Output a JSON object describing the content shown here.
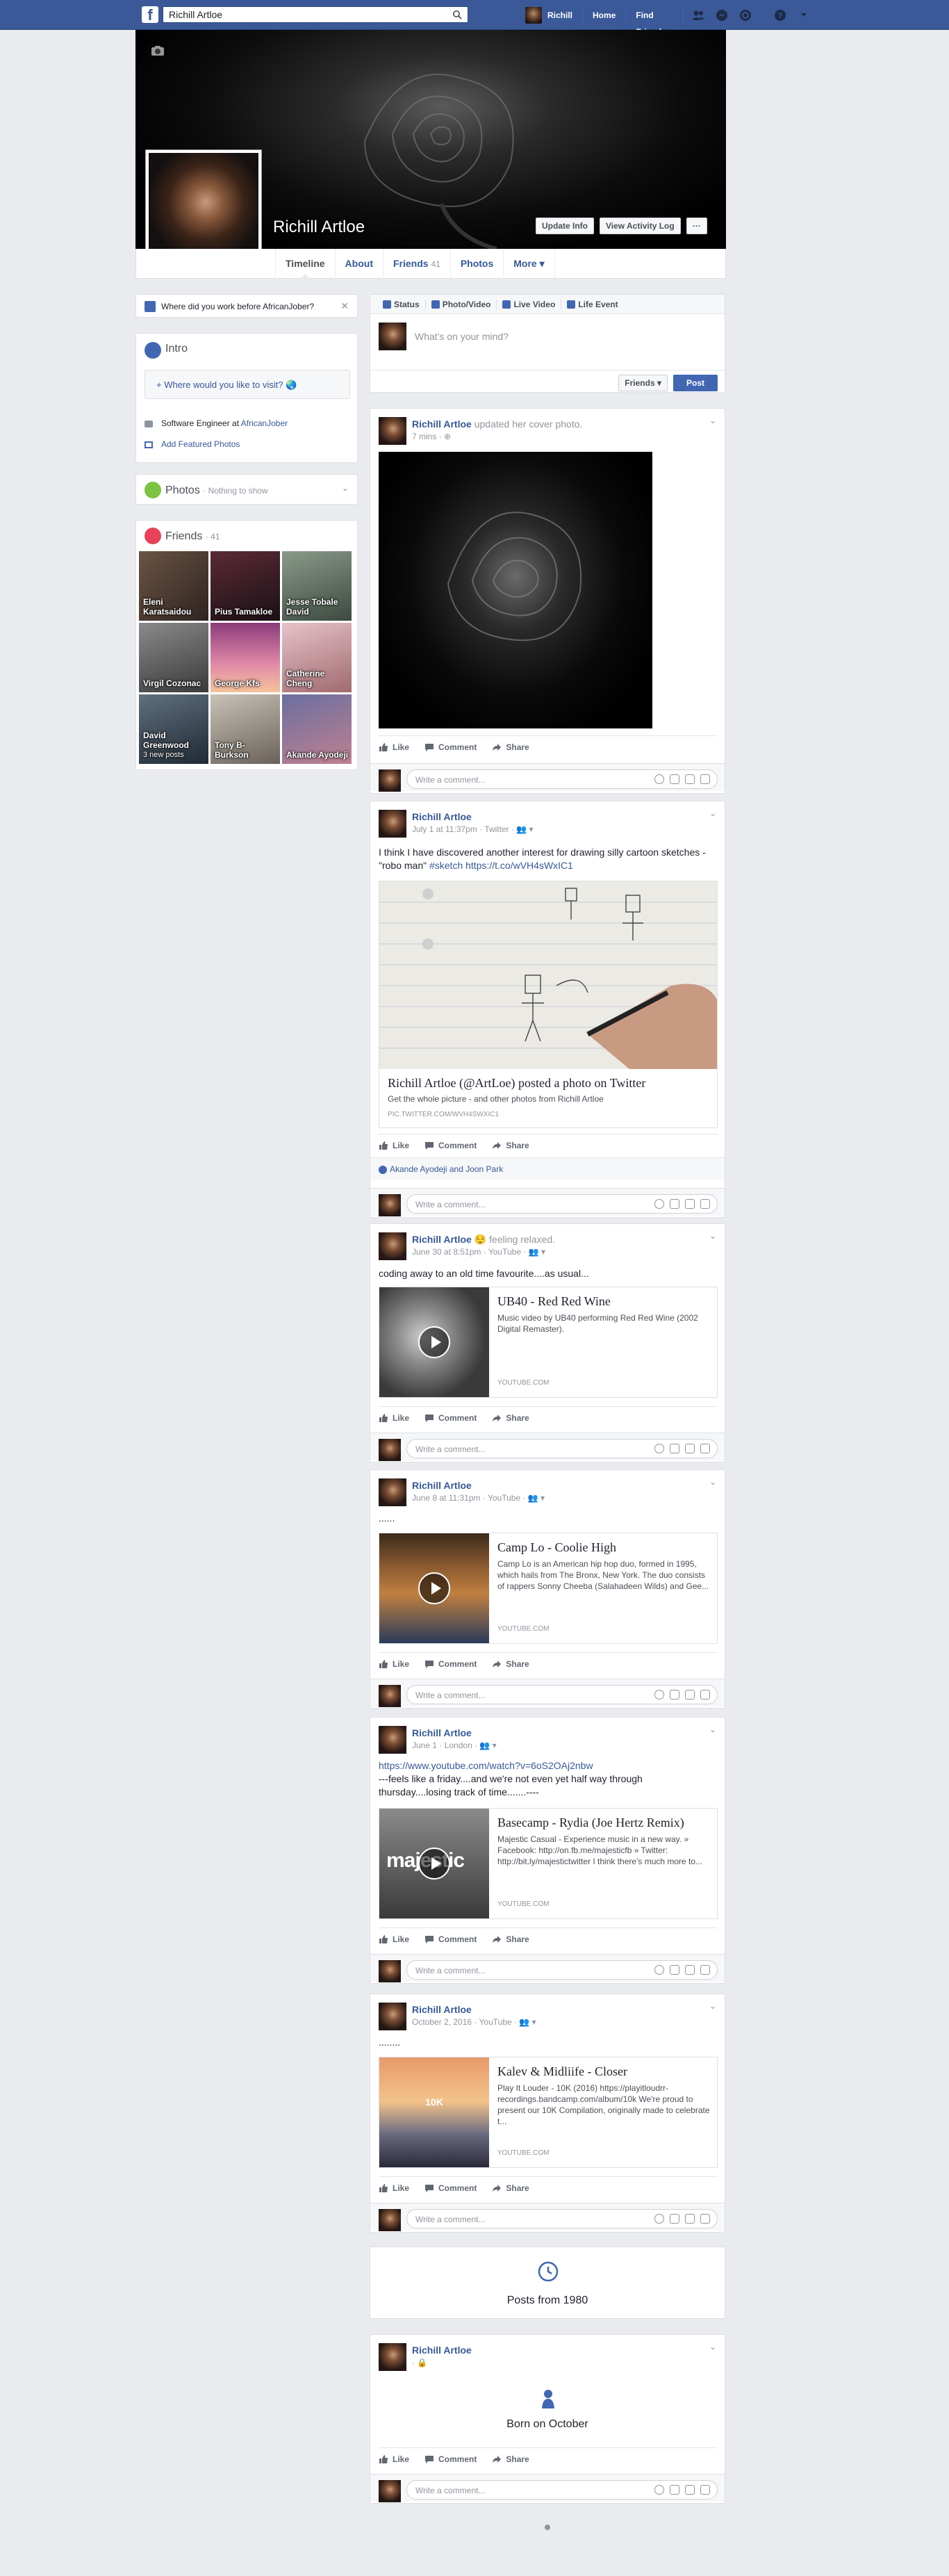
{
  "topbar": {
    "search_value": "Richill Artloe",
    "profile_name": "Richill",
    "home": "Home",
    "find_friends": "Find Friends"
  },
  "profile": {
    "name": "Richill Artloe",
    "update_info": "Update Info",
    "activity_log": "View Activity Log",
    "more_dots": "···"
  },
  "tabs": {
    "timeline": "Timeline",
    "about": "About",
    "friends": "Friends",
    "friends_count": "41",
    "photos": "Photos",
    "more": "More ▾"
  },
  "left": {
    "work_question": "Where did you work before AfricanJober?",
    "intro_title": "Intro",
    "visit_prompt": "+ Where would you like to visit? 🌏",
    "job_text": "Software Engineer at",
    "job_company": "AfricanJober",
    "featured": "Add Featured Photos",
    "photos_title": "Photos",
    "photos_sub": "· Nothing to show",
    "friends_title": "Friends",
    "friends_sub": "· 41",
    "friends": [
      {
        "name": "Eleni Karatsaidou",
        "extra": ""
      },
      {
        "name": "Pius Tamakloe",
        "extra": ""
      },
      {
        "name": "Jesse Tobale David",
        "extra": ""
      },
      {
        "name": "Virgil Cozonac",
        "extra": ""
      },
      {
        "name": "George Kfs",
        "extra": ""
      },
      {
        "name": "Catherine Cheng",
        "extra": ""
      },
      {
        "name": "David Greenwood",
        "extra": "3 new posts"
      },
      {
        "name": "Tony B-Burkson",
        "extra": ""
      },
      {
        "name": "Akande Ayodeji",
        "extra": ""
      }
    ]
  },
  "composer": {
    "status": "Status",
    "photo_video": "Photo/Video",
    "live_video": "Live Video",
    "life_event": "Life Event",
    "placeholder": "What's on your mind?",
    "audience": "Friends ▾",
    "post": "Post"
  },
  "actions": {
    "like": "Like",
    "comment": "Comment",
    "share": "Share",
    "write_comment": "Write a comment..."
  },
  "posts": [
    {
      "author": "Richill Artloe",
      "action": "updated her cover photo.",
      "meta": "7 mins · ⊕"
    },
    {
      "author": "Richill Artloe",
      "meta": "July 1 at 11:37pm · Twitter · 👥 ▾",
      "text1": "I think I have discovered another interest for drawing silly cartoon sketches -",
      "text2_a": "\"robo man\"",
      "text2_tag": "#sketch",
      "text2_link": "https://t.co/wVH4sWxIC1",
      "card_title": "Richill Artloe (@ArtLoe) posted a photo on Twitter",
      "card_desc": "Get the whole picture - and other photos from Richill Artloe",
      "card_src": "PIC.TWITTER.COM/WVH4SWXIC1",
      "likes": "Akande Ayodeji and Joon Park"
    },
    {
      "author": "Richill Artloe",
      "feeling": "😌 feeling relaxed.",
      "meta": "June 30 at 8:51pm · YouTube · 👥 ▾",
      "text": "coding away to an old time favourite....as usual...",
      "card_title": "UB40 - Red Red Wine",
      "card_desc": "Music video by UB40 performing Red Red Wine (2002 Digital Remaster).",
      "card_src": "YOUTUBE.COM"
    },
    {
      "author": "Richill Artloe",
      "meta": "June 8 at 11:31pm · YouTube · 👥 ▾",
      "text": "......",
      "card_title": "Camp Lo - Coolie High",
      "card_desc": "Camp Lo is an American hip hop duo, formed in 1995, which hails from The Bronx, New York. The duo consists of rappers Sonny Cheeba (Salahadeen Wilds) and Gee...",
      "card_src": "YOUTUBE.COM"
    },
    {
      "author": "Richill Artloe",
      "meta": "June 1 · London · 👥 ▾",
      "link": "https://www.youtube.com/watch?v=6oS2OAj2nbw",
      "text": "---feels like a friday....and we're not even yet half way through thursday....losing track of time.......----",
      "card_title": "Basecamp - Rydia (Joe Hertz Remix)",
      "card_desc": "Majestic Casual - Experience music in a new way. » Facebook: http://on.fb.me/majesticfb » Twitter: http://bit.ly/majestictwitter I think there's much more to...",
      "card_src": "YOUTUBE.COM",
      "thumb_text": "majestic"
    },
    {
      "author": "Richill Artloe",
      "meta": "October 2, 2016 · YouTube · 👥 ▾",
      "text": "........",
      "card_title": "Kalev & Midliife - Closer",
      "card_desc": "Play It Louder - 10K (2016) https://playitloudrr-recordings.bandcamp.com/album/10k We're proud to present our 10K Compilation, originally made to celebrate t...",
      "card_src": "YOUTUBE.COM",
      "thumb_text": "10K"
    }
  ],
  "year_marker": "Posts from 1980",
  "born": {
    "author": "Richill Artloe",
    "meta": "· 🔒",
    "text": "Born on October"
  },
  "colors": {
    "brand": "#3b5998",
    "accent": "#4267b2",
    "bg": "#e9ebee"
  }
}
